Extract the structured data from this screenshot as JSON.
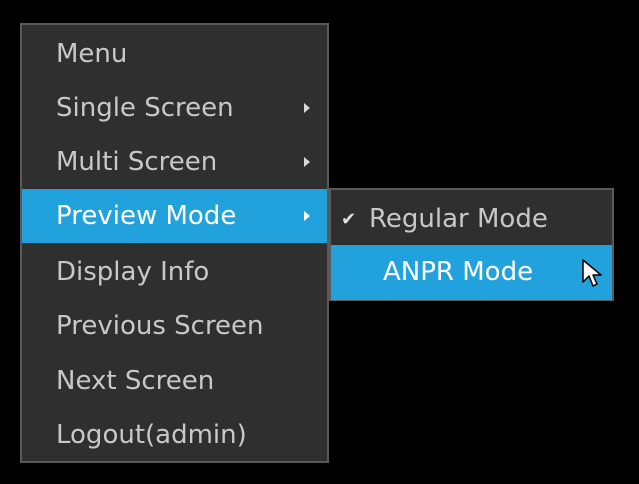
{
  "context_menu": {
    "items": [
      {
        "label": "Menu",
        "has_submenu": false
      },
      {
        "label": "Single Screen",
        "has_submenu": true
      },
      {
        "label": "Multi Screen",
        "has_submenu": true
      },
      {
        "label": "Preview Mode",
        "has_submenu": true,
        "highlighted": true
      },
      {
        "label": "Display Info",
        "has_submenu": false
      },
      {
        "label": "Previous Screen",
        "has_submenu": false
      },
      {
        "label": "Next Screen",
        "has_submenu": false
      },
      {
        "label": "Logout(admin)",
        "has_submenu": false
      }
    ]
  },
  "preview_mode_submenu": {
    "items": [
      {
        "label": "Regular Mode",
        "checked": true
      },
      {
        "label": "ANPR Mode",
        "highlighted": true
      }
    ]
  },
  "icons": {
    "checkmark": "checkmark-icon",
    "submenu_arrow": "chevron-right-icon",
    "cursor": "mouse-pointer-icon"
  },
  "colors": {
    "background": "#000000",
    "menu_bg": "#2f2f2f",
    "menu_border": "#5a5a5a",
    "highlight": "#22a2dd",
    "text": "#c8c8c8",
    "text_highlight": "#ffffff"
  }
}
